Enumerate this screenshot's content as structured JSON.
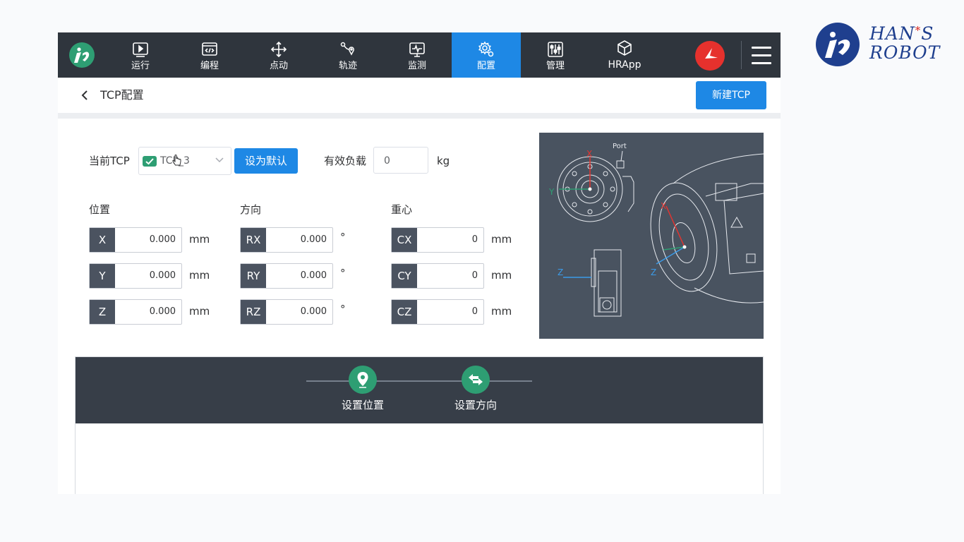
{
  "brand": {
    "line1": "HAN",
    "star": "*",
    "line1_end": "S",
    "line2": "ROBOT"
  },
  "nav": {
    "items": [
      {
        "label": "运行",
        "icon": "play-icon"
      },
      {
        "label": "编程",
        "icon": "code-icon"
      },
      {
        "label": "点动",
        "icon": "move-icon"
      },
      {
        "label": "轨迹",
        "icon": "trajectory-icon"
      },
      {
        "label": "监测",
        "icon": "monitor-icon"
      },
      {
        "label": "配置",
        "icon": "settings-icon",
        "active": true
      },
      {
        "label": "管理",
        "icon": "management-icon"
      },
      {
        "label": "HRApp",
        "icon": "cube-icon"
      }
    ],
    "accent": "#1e88e5",
    "background": "#2f353d"
  },
  "header": {
    "title": "TCP配置",
    "new_button": "新建TCP"
  },
  "tcp": {
    "label": "当前TCP",
    "selected": "TCP_3",
    "set_default": "设为默认",
    "payload_label": "有效负载",
    "payload_value": "0",
    "payload_unit": "kg"
  },
  "sections": {
    "position": {
      "title": "位置",
      "fields": [
        {
          "tag": "X",
          "value": "0.000",
          "unit": "mm"
        },
        {
          "tag": "Y",
          "value": "0.000",
          "unit": "mm"
        },
        {
          "tag": "Z",
          "value": "0.000",
          "unit": "mm"
        }
      ]
    },
    "orientation": {
      "title": "方向",
      "fields": [
        {
          "tag": "RX",
          "value": "0.000",
          "unit": "°"
        },
        {
          "tag": "RY",
          "value": "0.000",
          "unit": "°"
        },
        {
          "tag": "RZ",
          "value": "0.000",
          "unit": "°"
        }
      ]
    },
    "cog": {
      "title": "重心",
      "fields": [
        {
          "tag": "CX",
          "value": "0",
          "unit": "mm"
        },
        {
          "tag": "CY",
          "value": "0",
          "unit": "mm"
        },
        {
          "tag": "CZ",
          "value": "0",
          "unit": "mm"
        }
      ]
    }
  },
  "diagram": {
    "port": "Port",
    "x": "X",
    "y": "Y",
    "z": "Z"
  },
  "wizard": {
    "steps": [
      {
        "label": "设置位置",
        "icon": "location-pin-icon"
      },
      {
        "label": "设置方向",
        "icon": "direction-arrows-icon"
      }
    ],
    "step_color": "#2e9e73"
  }
}
